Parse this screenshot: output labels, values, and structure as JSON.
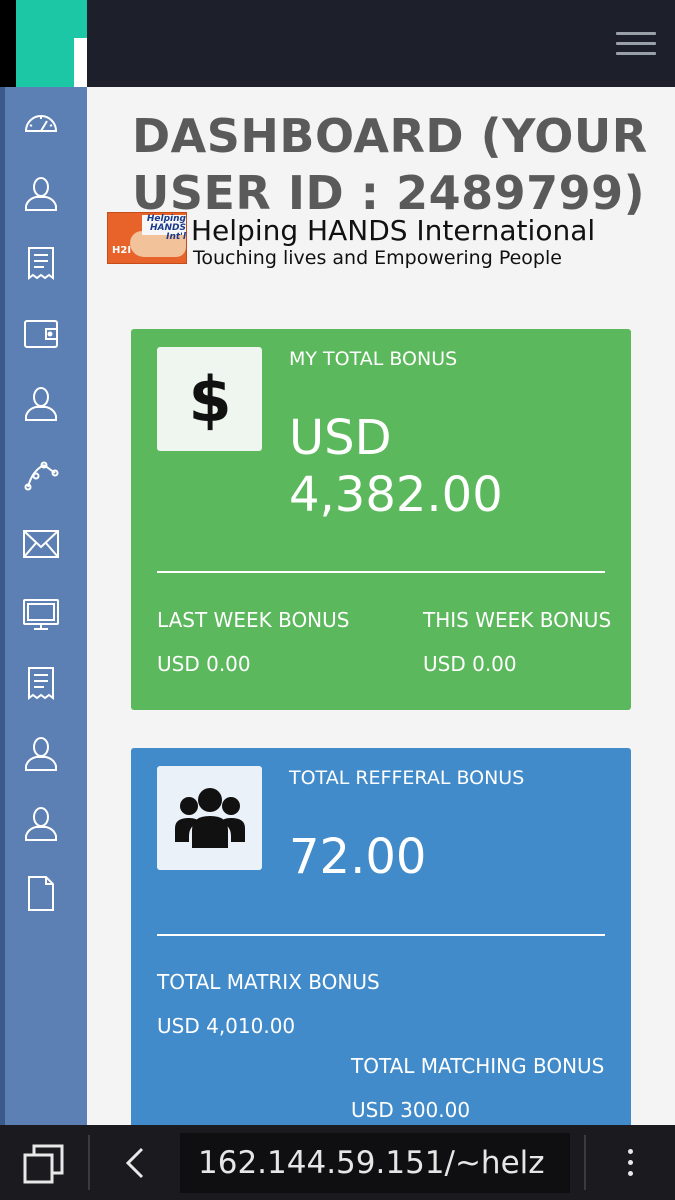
{
  "header": {
    "menu_icon": "hamburger-menu-icon"
  },
  "sidebar": {
    "items": [
      {
        "icon": "speedometer-icon"
      },
      {
        "icon": "user-icon"
      },
      {
        "icon": "receipt-icon"
      },
      {
        "icon": "wallet-icon"
      },
      {
        "icon": "user-icon"
      },
      {
        "icon": "network-icon"
      },
      {
        "icon": "envelope-icon"
      },
      {
        "icon": "monitor-icon"
      },
      {
        "icon": "receipt-icon"
      },
      {
        "icon": "user-icon"
      },
      {
        "icon": "user-icon"
      },
      {
        "icon": "document-icon"
      }
    ]
  },
  "main": {
    "title": "DASHBOARD (YOUR USER ID : 2489799)",
    "brand": {
      "logo_text": "Helping HANDS Int'l",
      "logo_mark": "H2I",
      "name": "Helping HANDS International",
      "tagline": "Touching lives and Empowering People"
    },
    "bonus_card": {
      "icon": "dollar-icon",
      "label": "MY TOTAL BONUS",
      "amount_currency": "USD",
      "amount_value": "4,382.00",
      "last_week_label": "LAST WEEK BONUS",
      "last_week_value": "USD 0.00",
      "this_week_label": "THIS WEEK BONUS",
      "this_week_value": "USD 0.00",
      "color": "#5cb85c"
    },
    "referral_card": {
      "icon": "users-icon",
      "label": "TOTAL REFFERAL BONUS",
      "amount_value": "72.00",
      "matrix_label": "TOTAL MATRIX BONUS",
      "matrix_value": "USD 4,010.00",
      "matching_label": "TOTAL MATCHING BONUS",
      "matching_value": "USD 300.00",
      "color": "#428bca"
    }
  },
  "browser": {
    "url": "162.144.59.151/~helz",
    "tabs_icon": "tabs-icon",
    "back_icon": "back-arrow-icon",
    "menu_icon": "more-vertical-icon"
  }
}
